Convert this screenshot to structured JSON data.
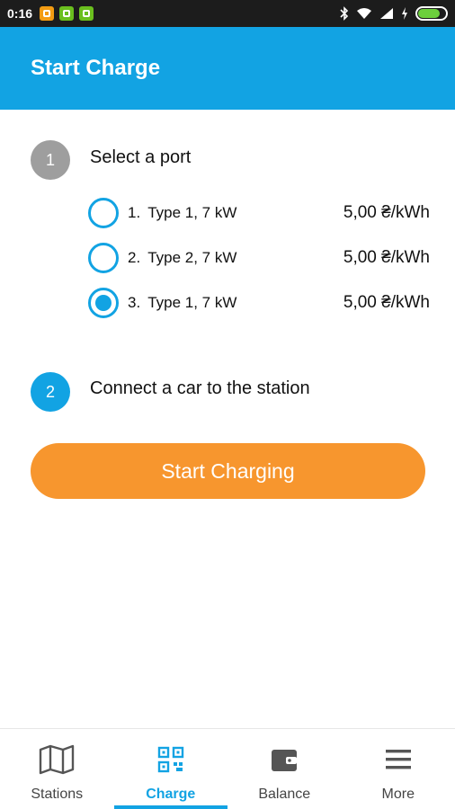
{
  "status_bar": {
    "time": "0:16",
    "notification_icons": [
      "app-notification-icon",
      "bag-notification-icon",
      "android-notification-icon"
    ],
    "system_icons": [
      "bluetooth-icon",
      "wifi-icon",
      "signal-icon",
      "charging-icon",
      "battery-icon"
    ],
    "battery_level": 0.75
  },
  "app_bar": {
    "title": "Start Charge"
  },
  "step1": {
    "number": "1",
    "label": "Select a port",
    "ports": [
      {
        "number": "1.",
        "name": "Type 1, 7 kW",
        "price": "5,00 ₴/kWh",
        "selected": false
      },
      {
        "number": "2.",
        "name": "Type 2, 7 kW",
        "price": "5,00 ₴/kWh",
        "selected": false
      },
      {
        "number": "3.",
        "name": "Type 1, 7 kW",
        "price": "5,00 ₴/kWh",
        "selected": true
      }
    ]
  },
  "step2": {
    "number": "2",
    "label": "Connect a car to the station"
  },
  "start_button": {
    "label": "Start Charging"
  },
  "colors": {
    "accent": "#12a3e3",
    "button": "#f7962e",
    "step_inactive": "#9e9e9e"
  },
  "bottom_nav": {
    "items": [
      {
        "label": "Stations",
        "icon": "map-icon",
        "active": false
      },
      {
        "label": "Charge",
        "icon": "qr-code-icon",
        "active": true
      },
      {
        "label": "Balance",
        "icon": "wallet-icon",
        "active": false
      },
      {
        "label": "More",
        "icon": "menu-icon",
        "active": false
      }
    ]
  }
}
